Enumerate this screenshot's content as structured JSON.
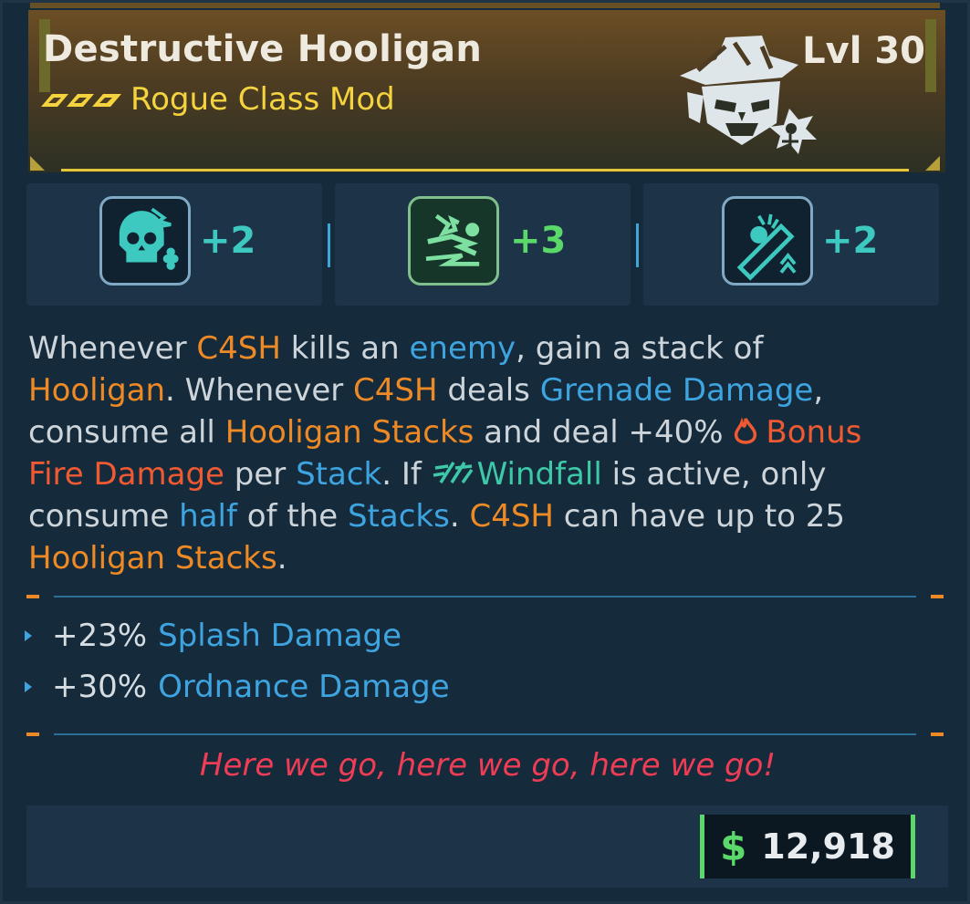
{
  "item": {
    "name": "Destructive Hooligan",
    "type": "Rogue Class Mod",
    "level": "Lvl 30",
    "rarity_color": "#f5d33f"
  },
  "skills": [
    {
      "icon": "skull-clover-icon",
      "value": "+2",
      "color": "#3dc9c0"
    },
    {
      "icon": "running-figure-icon",
      "value": "+3",
      "color": "#5bd86a"
    },
    {
      "icon": "grenade-launcher-icon",
      "value": "+2",
      "color": "#3dc9c0"
    }
  ],
  "description": {
    "l1": [
      "Whenever ",
      "C4SH",
      " kills an ",
      "enemy",
      ", gain a stack of"
    ],
    "l2": [
      "Hooligan",
      ". Whenever ",
      "C4SH",
      " deals ",
      "Grenade Damage",
      ","
    ],
    "l3": [
      "consume all ",
      "Hooligan Stacks",
      " and deal +40% ",
      "Bonus"
    ],
    "l4": [
      "Fire Damage",
      " per ",
      "Stack",
      ". If ",
      "Windfall",
      " is active, only"
    ],
    "l5": [
      "consume ",
      "half",
      " of the ",
      "Stacks",
      ". ",
      "C4SH",
      " can have up to 25"
    ],
    "l6": [
      "Hooligan Stacks",
      "."
    ]
  },
  "stats": [
    {
      "value": "+23%",
      "label": "Splash Damage"
    },
    {
      "value": "+30%",
      "label": "Ordnance Damage"
    }
  ],
  "flavor": "Here we go, here we go, here we go!",
  "price": {
    "currency_icon": "dollar-icon",
    "symbol": "$",
    "amount": "12,918"
  }
}
